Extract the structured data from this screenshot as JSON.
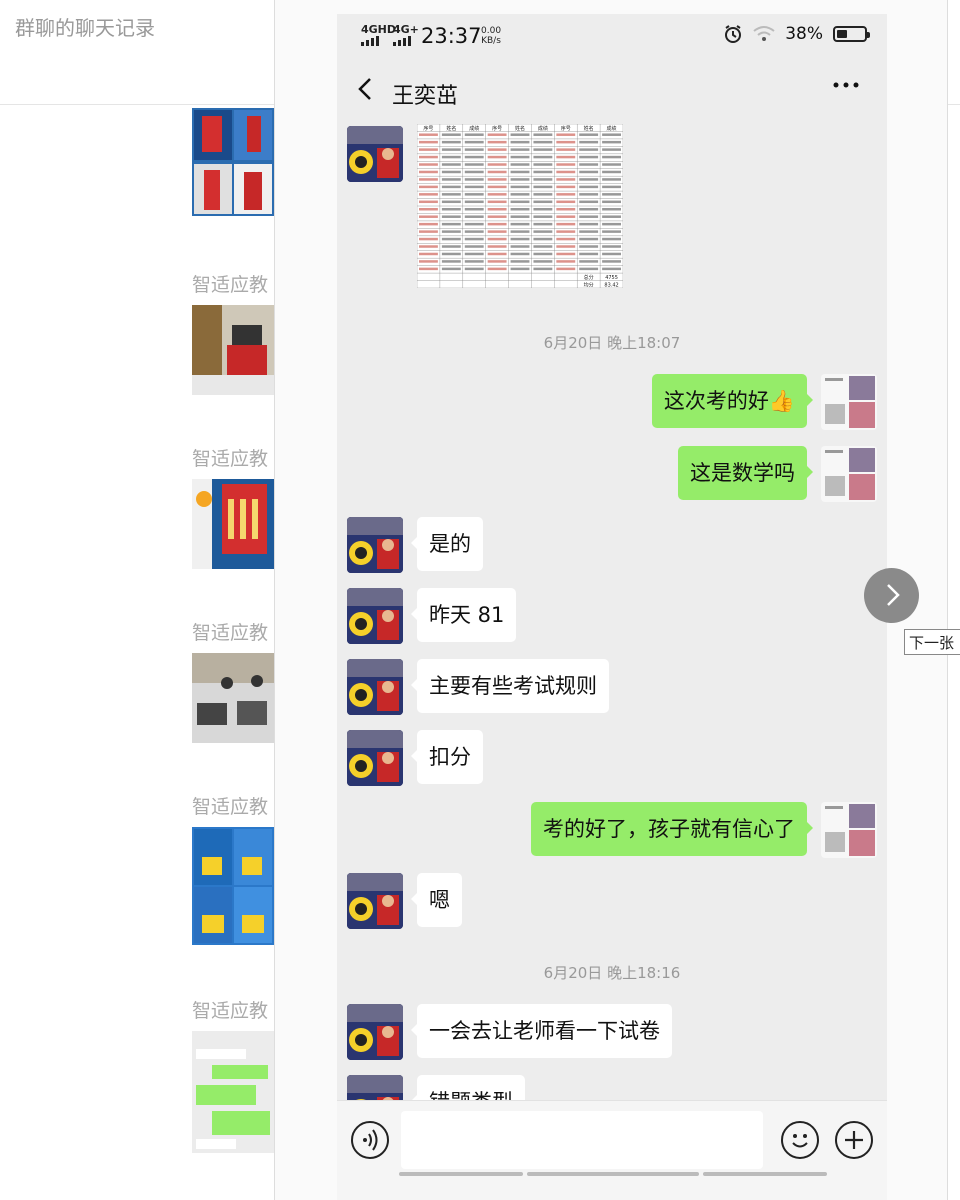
{
  "page": {
    "title": "群聊的聊天记录"
  },
  "feed": [
    {
      "label": ""
    },
    {
      "label": "智适应教"
    },
    {
      "label": "智适应教"
    },
    {
      "label": "智适应教"
    },
    {
      "label": "智适应教"
    },
    {
      "label": "智适应教"
    }
  ],
  "status_bar": {
    "network1": "4GHD",
    "network2": "4G+",
    "time": "23:37",
    "speed_value": "0.00",
    "speed_unit": "KB/s",
    "battery": "38%",
    "battery_level": 0.38
  },
  "chat": {
    "contact": "王奕茁",
    "back_icon": "chevron-left-icon",
    "more_icon": "more-dots-icon"
  },
  "score_table": {
    "headers": [
      "序号",
      "姓名",
      "成绩",
      "序号",
      "姓名",
      "成绩",
      "序号",
      "姓名",
      "成绩"
    ],
    "total_label": "总分",
    "total_value": "4755",
    "avg_label": "均分",
    "avg_value": "83.42"
  },
  "messages": [
    {
      "side": "time",
      "text": "6月20日 晚上18:07"
    },
    {
      "side": "right",
      "text": "这次考的好👍"
    },
    {
      "side": "right",
      "text": "这是数学吗"
    },
    {
      "side": "left",
      "text": "是的"
    },
    {
      "side": "left",
      "text": "昨天 81"
    },
    {
      "side": "left",
      "text": "主要有些考试规则"
    },
    {
      "side": "left",
      "text": "扣分"
    },
    {
      "side": "right",
      "text": "考的好了，孩子就有信心了"
    },
    {
      "side": "left",
      "text": "嗯"
    },
    {
      "side": "time",
      "text": "6月20日 晚上18:16"
    },
    {
      "side": "left",
      "text": "一会去让老师看一下试卷"
    },
    {
      "side": "left",
      "text": "错题类型"
    }
  ],
  "input_bar": {
    "voice_icon": "voice-icon",
    "emoji_icon": "emoji-icon",
    "plus_icon": "plus-icon"
  },
  "viewer": {
    "next_label": "下一张"
  }
}
